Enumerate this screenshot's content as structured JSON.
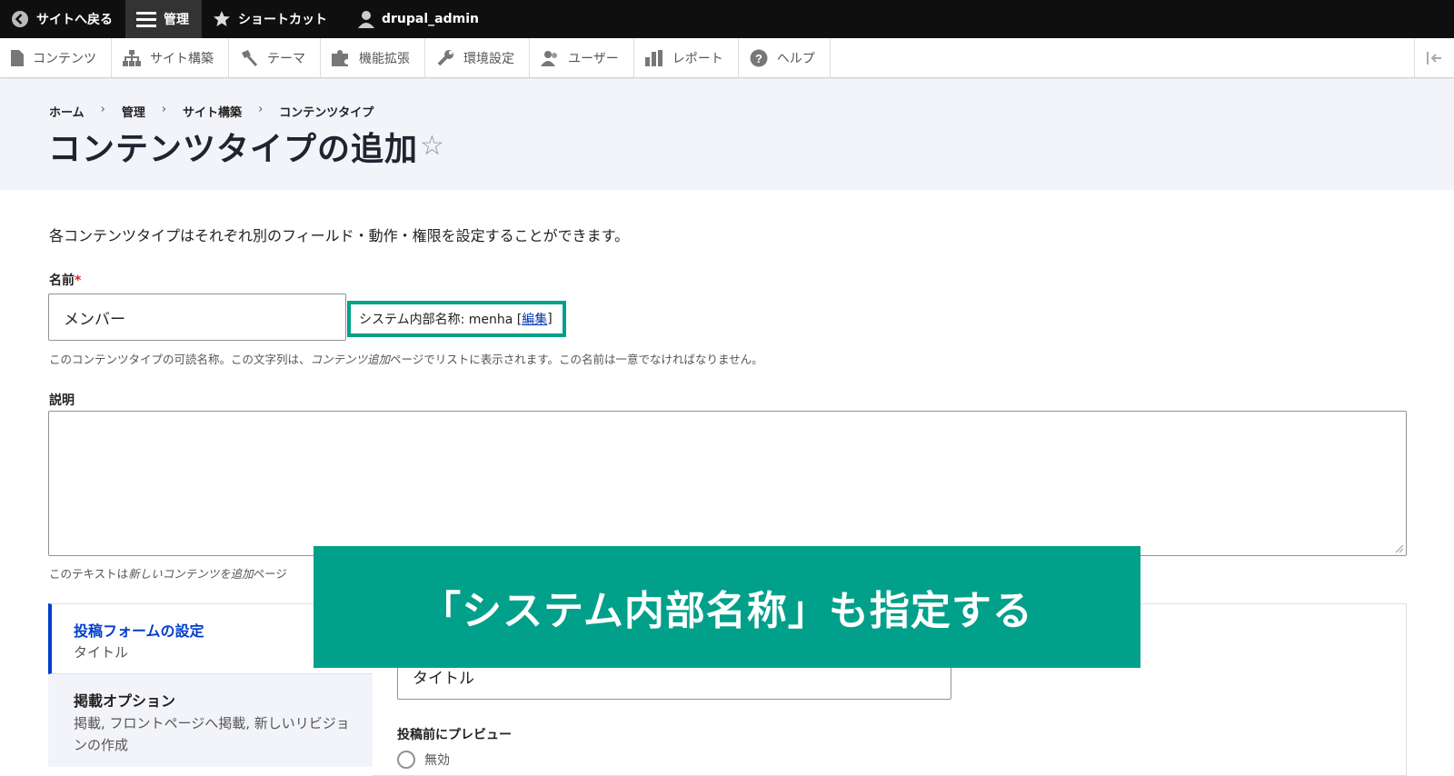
{
  "toolbar": {
    "back": "サイトへ戻る",
    "manage": "管理",
    "shortcuts": "ショートカット",
    "user": "drupal_admin"
  },
  "tray": {
    "items": [
      "コンテンツ",
      "サイト構築",
      "テーマ",
      "機能拡張",
      "環境設定",
      "ユーザー",
      "レポート",
      "ヘルプ"
    ]
  },
  "breadcrumb": [
    "ホーム",
    "管理",
    "サイト構築",
    "コンテンツタイプ"
  ],
  "breadcrumb_sep": "›",
  "page": {
    "title": "コンテンツタイプの追加",
    "star": "☆",
    "intro": "各コンテンツタイプはそれぞれ別のフィールド・動作・権限を設定することができます。"
  },
  "form": {
    "name_label": "名前",
    "required_mark": "*",
    "name_value": "メンバー",
    "machine_prefix": "システム内部名称: menha [",
    "machine_edit": "編集",
    "machine_suffix": "]",
    "name_help_1": "このコンテンツタイプの可読名称。この文字列は、",
    "name_help_em": "コンテンツ追加",
    "name_help_2": "ページでリストに表示されます。この名前は一意でなければなりません。",
    "desc_label": "説明",
    "desc_help_1": "このテキストは",
    "desc_help_em": "新しいコンテンツを追加",
    "desc_help_2": "ページ"
  },
  "vertical_tabs": {
    "tab1_title": "投稿フォームの設定",
    "tab1_summary": "タイトル",
    "tab2_title": "掲載オプション",
    "tab2_summary": "掲載, フロントページへ掲載, 新しいリビジョンの作成",
    "title_field_value": "タイトル",
    "preview_label": "投稿前にプレビュー",
    "preview_option": "無効"
  },
  "banner": {
    "text": "「システム内部名称」も指定する"
  },
  "colors": {
    "toolbar_bg": "#0f0f0f",
    "accent_blue": "#003ecc",
    "banner_green": "#00a08a",
    "header_bg": "#f3f4f9"
  }
}
